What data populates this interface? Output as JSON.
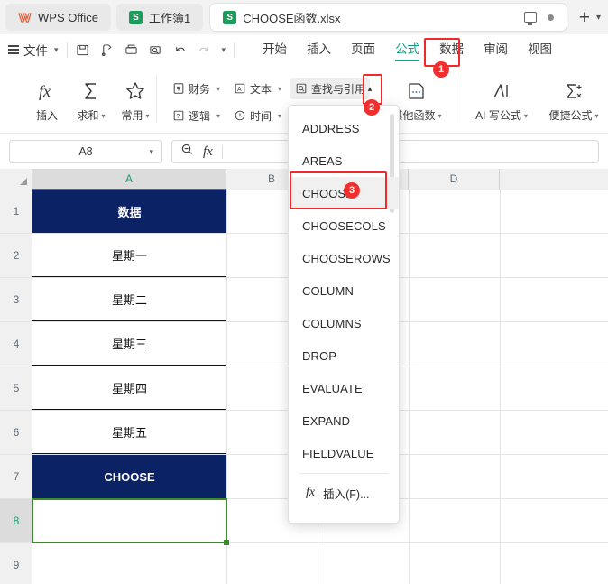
{
  "window": {
    "tabs": [
      {
        "name": "wps-office",
        "label": "WPS Office",
        "icon": "wps-logo"
      },
      {
        "name": "workbook1",
        "label": "工作簿1",
        "icon": "sheet-icon"
      },
      {
        "name": "choose-xlsx",
        "label": "CHOOSE函数.xlsx",
        "icon": "sheet-icon"
      }
    ],
    "right_icons": [
      "monitor-icon",
      "dot-icon",
      "plus-icon",
      "chevron-down-icon"
    ]
  },
  "menubar": {
    "file_label": "文件",
    "quick_icons": [
      "save-icon",
      "save-as-icon",
      "print-icon",
      "print-preview-icon",
      "undo-icon",
      "redo-icon",
      "customize-chevron-icon"
    ],
    "ribbon_tabs": [
      {
        "label": "开始",
        "active": false
      },
      {
        "label": "插入",
        "active": false
      },
      {
        "label": "页面",
        "active": false
      },
      {
        "label": "公式",
        "active": true
      },
      {
        "label": "数据",
        "active": false
      },
      {
        "label": "审阅",
        "active": false
      },
      {
        "label": "视图",
        "active": false
      }
    ]
  },
  "ribbon": {
    "big_buttons": [
      {
        "label": "插入",
        "icon": "fx-icon",
        "caret": false
      },
      {
        "label": "求和",
        "icon": "sigma-icon",
        "caret": true
      },
      {
        "label": "常用",
        "icon": "star-icon",
        "caret": true
      }
    ],
    "small_buttons": [
      {
        "label": "财务",
        "icon": "finance-icon",
        "caret": true
      },
      {
        "label": "文本",
        "icon": "text-icon",
        "caret": true
      },
      {
        "label": "逻辑",
        "icon": "logic-icon",
        "caret": true
      },
      {
        "label": "时间",
        "icon": "clock-icon",
        "caret": true
      },
      {
        "label": "查找与引用",
        "icon": "lookup-icon",
        "caret": true
      }
    ],
    "right_buttons": [
      {
        "label": "其他函数",
        "icon": "other-functions-icon",
        "caret": true
      },
      {
        "label": "AI 写公式",
        "icon": "ai-icon",
        "caret": true
      },
      {
        "label": "便捷公式",
        "icon": "quick-formula-icon",
        "caret": true
      }
    ]
  },
  "formula_bar": {
    "name_box_value": "A8",
    "formula_value": "",
    "formula_placeholder": ""
  },
  "dropdown": {
    "items": [
      "ADDRESS",
      "AREAS",
      "CHOOSE",
      "CHOOSECOLS",
      "CHOOSEROWS",
      "COLUMN",
      "COLUMNS",
      "DROP",
      "EVALUATE",
      "EXPAND",
      "FIELDVALUE"
    ],
    "highlighted": "CHOOSE",
    "insert_label": "插入(F)..."
  },
  "badges": [
    {
      "num": "1",
      "target": "formula-ribbon-tab"
    },
    {
      "num": "2",
      "target": "lookup-expand-arrow"
    },
    {
      "num": "3",
      "target": "choose-menu-item"
    }
  ],
  "sheet": {
    "columns": [
      "A",
      "B",
      "C",
      "D"
    ],
    "rows": [
      "1",
      "2",
      "3",
      "4",
      "5",
      "6",
      "7",
      "8",
      "9"
    ],
    "selected_cell": "A8",
    "cells": [
      {
        "ref": "A1",
        "value": "数据",
        "style": "hdrfill"
      },
      {
        "ref": "A2",
        "value": "星期一",
        "style": "datafill"
      },
      {
        "ref": "A3",
        "value": "星期二",
        "style": "datafill"
      },
      {
        "ref": "A4",
        "value": "星期三",
        "style": "datafill"
      },
      {
        "ref": "A5",
        "value": "星期四",
        "style": "datafill"
      },
      {
        "ref": "A6",
        "value": "星期五",
        "style": "datafill"
      },
      {
        "ref": "A7",
        "value": "CHOOSE",
        "style": "hdrfill"
      },
      {
        "ref": "A8",
        "value": "",
        "style": "selected"
      }
    ]
  },
  "colors": {
    "navy": "#0b2265",
    "accent_teal": "#13a085",
    "badge_red": "#f22f2f",
    "selection_green": "#3c8a2e"
  }
}
